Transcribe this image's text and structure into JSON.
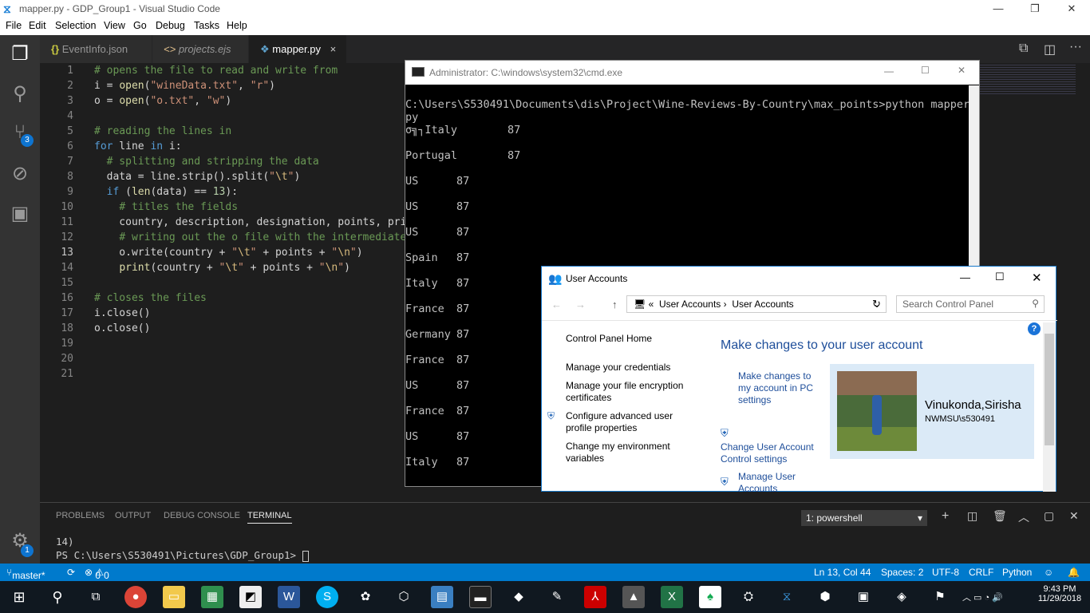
{
  "window_title": "mapper.py - GDP_Group1 - Visual Studio Code",
  "menu": [
    "File",
    "Edit",
    "Selection",
    "View",
    "Go",
    "Debug",
    "Tasks",
    "Help"
  ],
  "tabs": [
    {
      "label": "EventInfo.json",
      "icon": "json-icon"
    },
    {
      "label": "projects.ejs",
      "icon": "ejs-icon"
    },
    {
      "label": "mapper.py",
      "icon": "python-icon",
      "close": "×"
    }
  ],
  "activity_badges": {
    "scm": "3",
    "settings": "1"
  },
  "code_lines": [
    {
      "n": "1",
      "tokens": [
        [
          "cm",
          "# opens the file to read and write from"
        ]
      ]
    },
    {
      "n": "2",
      "tokens": [
        [
          "",
          "i = "
        ],
        [
          "fn",
          "open"
        ],
        [
          "",
          "("
        ],
        [
          "st",
          "\"wineData.txt\""
        ],
        [
          "",
          ", "
        ],
        [
          "st",
          "\"r\""
        ],
        [
          "",
          ")"
        ]
      ]
    },
    {
      "n": "3",
      "tokens": [
        [
          "",
          "o = "
        ],
        [
          "fn",
          "open"
        ],
        [
          "",
          "("
        ],
        [
          "st",
          "\"o.txt\""
        ],
        [
          "",
          ", "
        ],
        [
          "st",
          "\"w\""
        ],
        [
          "",
          ")"
        ]
      ]
    },
    {
      "n": "4",
      "tokens": []
    },
    {
      "n": "5",
      "tokens": [
        [
          "cm",
          "# reading the lines in"
        ]
      ]
    },
    {
      "n": "6",
      "tokens": [
        [
          "kw",
          "for"
        ],
        [
          "",
          " line "
        ],
        [
          "kw",
          "in"
        ],
        [
          "",
          " i:"
        ]
      ]
    },
    {
      "n": "7",
      "tokens": [
        [
          "",
          "  "
        ],
        [
          "cm",
          "# splitting and stripping the data"
        ]
      ]
    },
    {
      "n": "8",
      "tokens": [
        [
          "",
          "  data = line.strip().split("
        ],
        [
          "st",
          "\""
        ],
        [
          "es",
          "\\t"
        ],
        [
          "st",
          "\""
        ],
        [
          "",
          ")"
        ]
      ]
    },
    {
      "n": "9",
      "tokens": [
        [
          "",
          "  "
        ],
        [
          "kw",
          "if"
        ],
        [
          "",
          " ("
        ],
        [
          "fn",
          "len"
        ],
        [
          "",
          "(data) == "
        ],
        [
          "nu",
          "13"
        ],
        [
          "",
          "):"
        ]
      ]
    },
    {
      "n": "10",
      "tokens": [
        [
          "",
          "    "
        ],
        [
          "cm",
          "# titles the fields"
        ]
      ]
    },
    {
      "n": "11",
      "tokens": [
        [
          "",
          "    country, description, designation, points, pric"
        ]
      ]
    },
    {
      "n": "12",
      "tokens": [
        [
          "",
          "    "
        ],
        [
          "cm",
          "# writing out the o file with the intermediate"
        ]
      ]
    },
    {
      "n": "13",
      "tokens": [
        [
          "",
          "    o.write(country + "
        ],
        [
          "st",
          "\""
        ],
        [
          "es",
          "\\t"
        ],
        [
          "st",
          "\""
        ],
        [
          "",
          " + points + "
        ],
        [
          "st",
          "\""
        ],
        [
          "es",
          "\\n"
        ],
        [
          "st",
          "\""
        ],
        [
          "",
          ")"
        ]
      ]
    },
    {
      "n": "14",
      "tokens": [
        [
          "",
          "    "
        ],
        [
          "fn",
          "print"
        ],
        [
          "",
          "(country + "
        ],
        [
          "st",
          "\""
        ],
        [
          "es",
          "\\t"
        ],
        [
          "st",
          "\""
        ],
        [
          "",
          " + points + "
        ],
        [
          "st",
          "\""
        ],
        [
          "es",
          "\\n"
        ],
        [
          "st",
          "\""
        ],
        [
          "",
          ")"
        ]
      ]
    },
    {
      "n": "15",
      "tokens": []
    },
    {
      "n": "16",
      "tokens": [
        [
          "cm",
          "# closes the files"
        ]
      ]
    },
    {
      "n": "17",
      "tokens": [
        [
          "",
          "i.close()"
        ]
      ]
    },
    {
      "n": "18",
      "tokens": [
        [
          "",
          "o.close()"
        ]
      ]
    },
    {
      "n": "19",
      "tokens": []
    },
    {
      "n": "20",
      "tokens": []
    },
    {
      "n": "21",
      "tokens": []
    }
  ],
  "current_line": "13",
  "panel": {
    "tabs": [
      "PROBLEMS",
      "OUTPUT",
      "DEBUG CONSOLE",
      "TERMINAL"
    ],
    "active_tab": "TERMINAL",
    "terminal_select": "1: powershell",
    "terminal_lines": [
      "14)",
      "PS C:\\Users\\S530491\\Pictures\\GDP_Group1> "
    ]
  },
  "status": {
    "branch": "master*",
    "errors": "0",
    "warnings": "0",
    "position": "Ln 13, Col 44",
    "spaces": "Spaces: 2",
    "encoding": "UTF-8",
    "eol": "CRLF",
    "language": "Python"
  },
  "cmd": {
    "title": "Administrator: C:\\windows\\system32\\cmd.exe",
    "command": "C:\\Users\\S530491\\Documents\\dis\\Project\\Wine-Reviews-By-Country\\max_points>python mapper.",
    "command_wrap": "py",
    "rows": [
      {
        "country": "σ╗┐Italy",
        "points": "87"
      },
      {
        "country": "Portugal",
        "points": "87"
      },
      {
        "country": "US",
        "points": "87"
      },
      {
        "country": "US",
        "points": "87"
      },
      {
        "country": "US",
        "points": "87"
      },
      {
        "country": "Spain",
        "points": "87"
      },
      {
        "country": "Italy",
        "points": "87"
      },
      {
        "country": "France",
        "points": "87"
      },
      {
        "country": "Germany",
        "points": "87"
      },
      {
        "country": "France",
        "points": "87"
      },
      {
        "country": "US",
        "points": "87"
      },
      {
        "country": "France",
        "points": "87"
      },
      {
        "country": "US",
        "points": "87"
      },
      {
        "country": "Italy",
        "points": "87"
      }
    ]
  },
  "user_accounts": {
    "title": "User Accounts",
    "breadcrumb": [
      "«",
      "User Accounts",
      "User Accounts"
    ],
    "search_placeholder": "Search Control Panel",
    "left_links": [
      "Control Panel Home",
      "Manage your credentials",
      "Manage your file encryption certificates",
      "Configure advanced user profile properties",
      "Change my environment variables"
    ],
    "heading": "Make changes to your user account",
    "actions": [
      "Make changes to my account in PC settings",
      "Change User Account Control settings",
      "Manage User Accounts"
    ],
    "user_name": "Vinukonda,Sirisha",
    "user_id": "NWMSU\\s530491"
  },
  "clock": {
    "time": "9:43 PM",
    "date": "11/29/2018"
  },
  "colors": {
    "accent": "#007acc",
    "activity": "#333333",
    "editor": "#1e1e1e"
  }
}
